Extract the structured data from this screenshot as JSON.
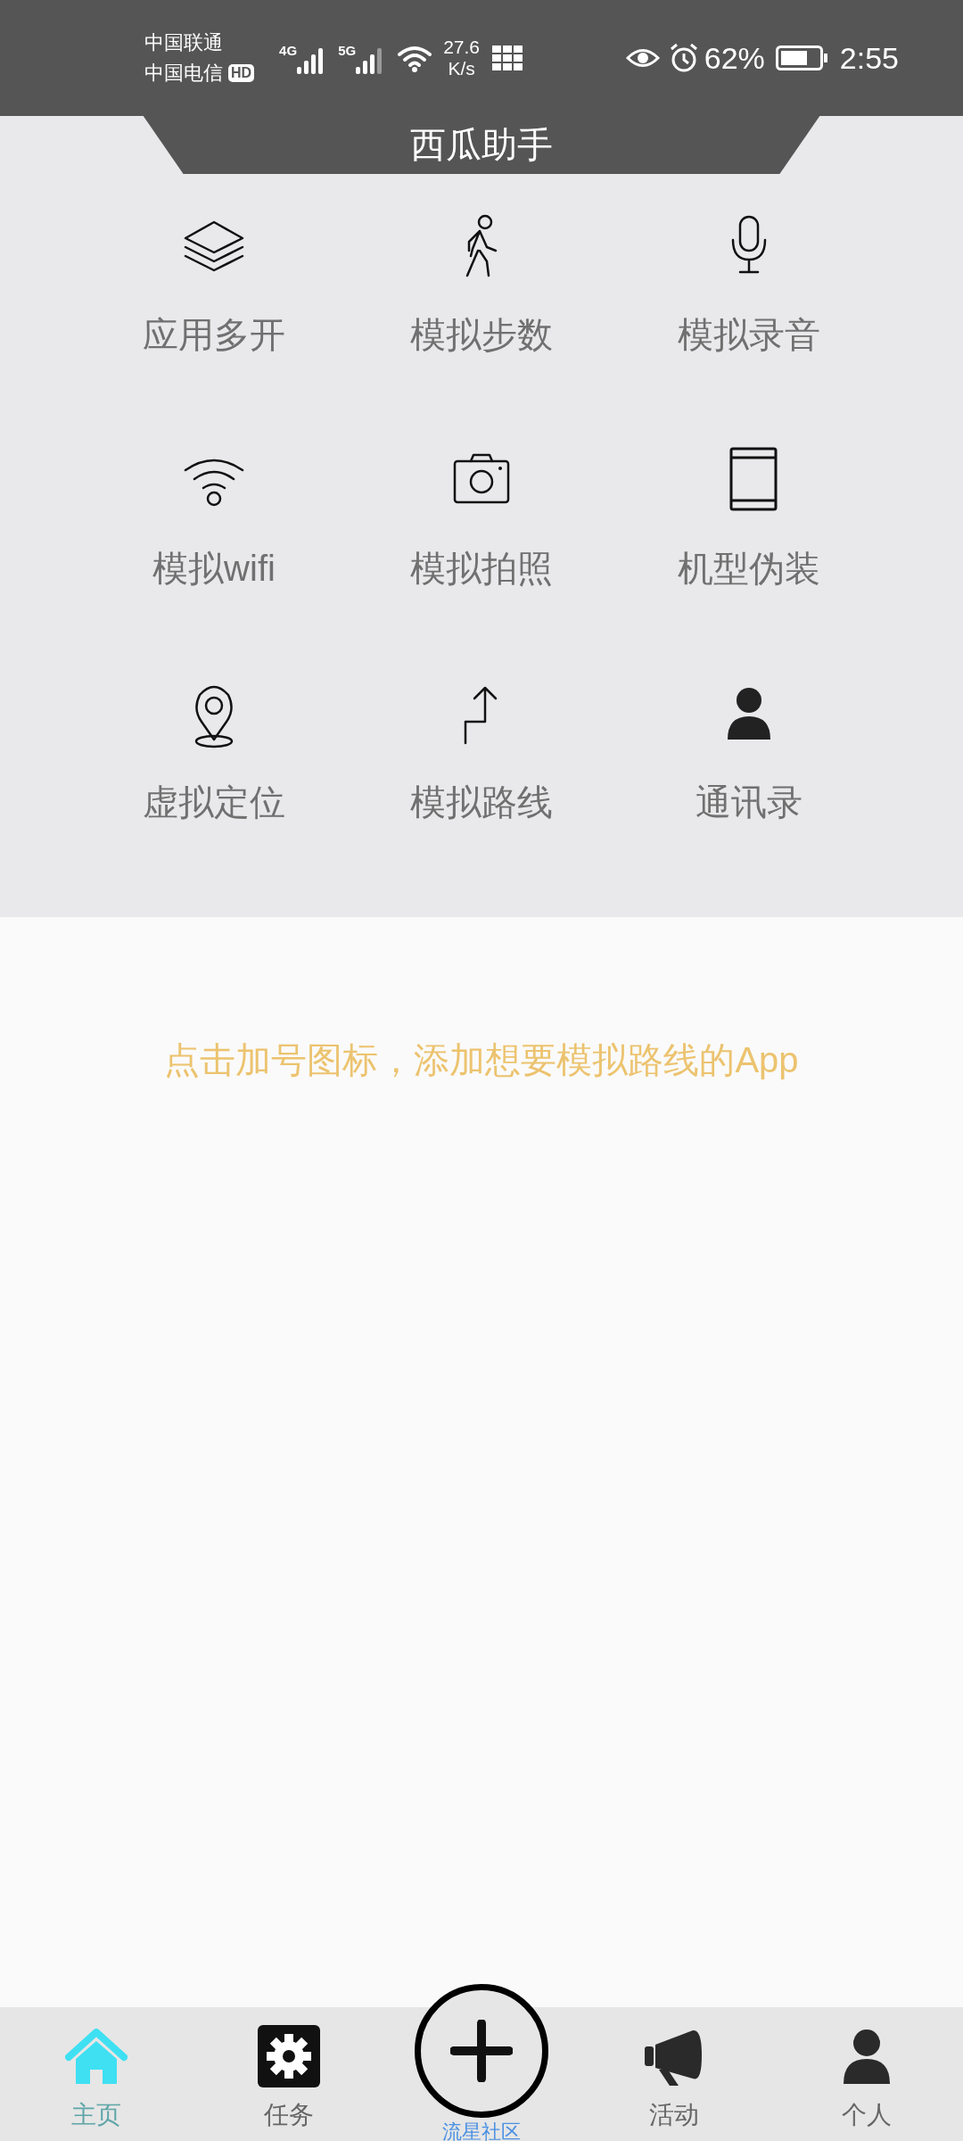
{
  "status_bar": {
    "carriers": [
      "中国联通",
      "中国电信"
    ],
    "hd": "HD",
    "net_4g": "4G",
    "net_5g": "5G",
    "speed_value": "27.6",
    "speed_unit": "K/s",
    "battery_percent": "62%",
    "time": "2:55"
  },
  "header": {
    "title": "西瓜助手"
  },
  "features": [
    {
      "label": "应用多开"
    },
    {
      "label": "模拟步数"
    },
    {
      "label": "模拟录音"
    },
    {
      "label": "模拟wifi"
    },
    {
      "label": "模拟拍照"
    },
    {
      "label": "机型伪装"
    },
    {
      "label": "虚拟定位"
    },
    {
      "label": "模拟路线"
    },
    {
      "label": "通讯录"
    }
  ],
  "hint": "点击加号图标，添加想要模拟路线的App",
  "bottom_nav": [
    {
      "kind": "tab",
      "label": "主页",
      "selected": true
    },
    {
      "kind": "tab",
      "label": "任务",
      "selected": false
    },
    {
      "kind": "add",
      "label": "流星社区",
      "selected": false
    },
    {
      "kind": "tab",
      "label": "活动",
      "selected": false
    },
    {
      "kind": "tab",
      "label": "个人",
      "selected": false
    }
  ]
}
